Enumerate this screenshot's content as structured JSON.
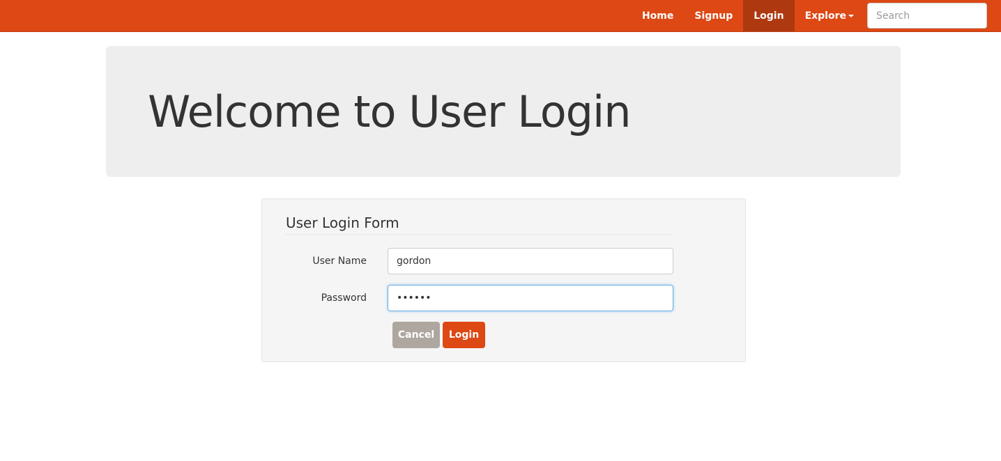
{
  "nav": {
    "items": [
      {
        "label": "Home",
        "active": false
      },
      {
        "label": "Signup",
        "active": false
      },
      {
        "label": "Login",
        "active": true
      }
    ],
    "explore_label": "Explore",
    "search_placeholder": "Search"
  },
  "hero": {
    "title": "Welcome to User Login"
  },
  "form": {
    "legend": "User Login Form",
    "username_label": "User Name",
    "username_value": "gordon",
    "password_label": "Password",
    "password_value": "••••••",
    "cancel_label": "Cancel",
    "login_label": "Login"
  },
  "colors": {
    "brand": "#dd4814",
    "brand_active": "#ae3910",
    "cancel": "#aea79f",
    "jumbotron_bg": "#eeeeee",
    "well_bg": "#f5f5f5"
  }
}
